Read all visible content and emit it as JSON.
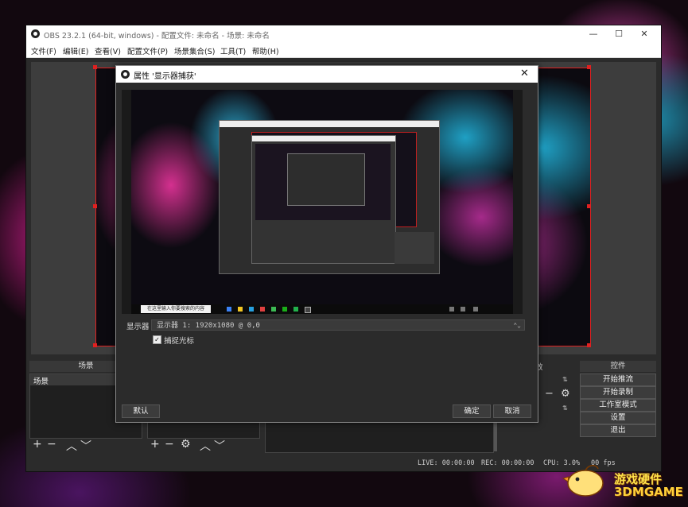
{
  "window": {
    "title": "OBS 23.2.1 (64-bit, windows) - 配置文件: 未命名 - 场景: 未命名",
    "minimize": "—",
    "maximize": "☐",
    "close": "✕"
  },
  "menu": [
    "文件(F)",
    "编辑(E)",
    "查看(V)",
    "配置文件(P)",
    "场景集合(S)",
    "工具(T)",
    "帮助(H)"
  ],
  "docks": {
    "scenes": {
      "header": "场景",
      "items": [
        "场景"
      ]
    },
    "mixer": {
      "header": "效"
    },
    "controls": {
      "header": "控件",
      "buttons": [
        "开始推流",
        "开始录制",
        "工作室模式",
        "设置",
        "退出"
      ]
    }
  },
  "status": {
    "live": "LIVE: 00:00:00",
    "rec": "REC: 00:00:00",
    "cpu": "CPU: 3.0%",
    "fps": "00 fps"
  },
  "dialog": {
    "title": "属性 '显示器捕获'",
    "close": "✕",
    "display_label": "显示器",
    "display_value": "显示器 1: 1920x1080 @ 0,0",
    "capture_cursor_label": "捕捉光标",
    "capture_cursor_checked": true,
    "checkmark": "✓",
    "defaults_button": "默认",
    "ok_button": "确定",
    "cancel_button": "取消",
    "taskbar_search": "在这里输入你要搜索的内容"
  },
  "watermark": {
    "line1": "游戏硬件",
    "line2": "3DMGAME"
  },
  "colors": {
    "selection_border": "#e02020",
    "panel_bg": "#2b2b2b",
    "watermark": "#ffe34a"
  }
}
